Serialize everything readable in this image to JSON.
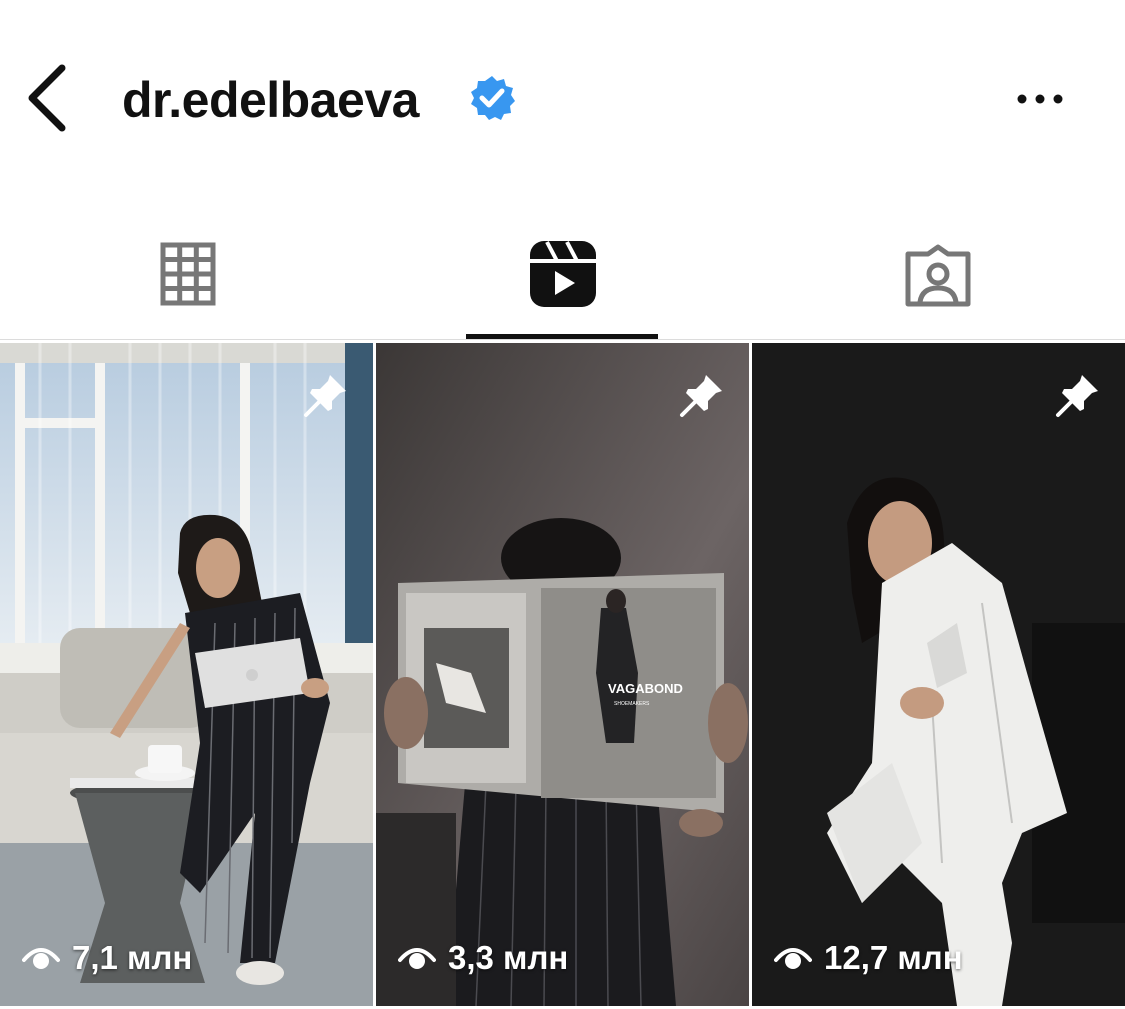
{
  "header": {
    "username": "dr.edelbaeva",
    "verified": true,
    "back_icon": "chevron-left-icon",
    "more_icon": "more-horizontal-icon",
    "verified_color": "#3897f0"
  },
  "tabs": [
    {
      "name": "grid",
      "icon": "grid-icon",
      "active": false
    },
    {
      "name": "reels",
      "icon": "reels-icon",
      "active": true
    },
    {
      "name": "tagged",
      "icon": "tagged-person-icon",
      "active": false
    }
  ],
  "reels": [
    {
      "views": "7,1 млн",
      "pinned": true
    },
    {
      "views": "3,3 млн",
      "pinned": true,
      "magazine_text": "VAGABOND",
      "magazine_subtext": "SHOEMAKERS"
    },
    {
      "views": "12,7 млн",
      "pinned": true
    }
  ]
}
